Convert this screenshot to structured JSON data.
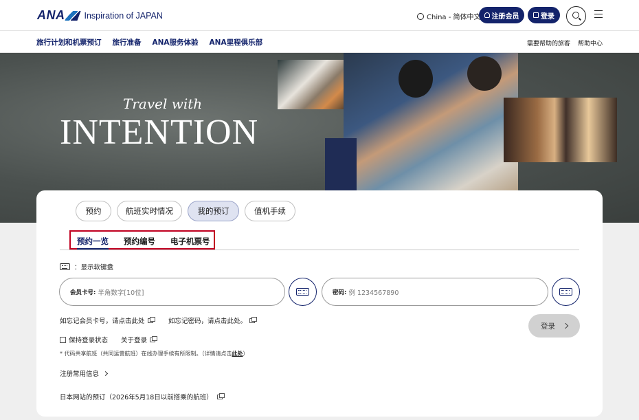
{
  "header": {
    "logo_text": "ANA",
    "tagline": "Inspiration of JAPAN",
    "language": "China - 简体中文",
    "register_label": "注册会员",
    "login_label": "登录"
  },
  "nav": {
    "left": [
      "旅行计划和机票预订",
      "旅行准备",
      "ANA服务体验",
      "ANA里程俱乐部"
    ],
    "right": [
      "需要帮助的旅客",
      "帮助中心"
    ]
  },
  "hero": {
    "line1": "Travel with",
    "line2": "INTENTION"
  },
  "booking": {
    "tabs": [
      "预约",
      "航班实时情况",
      "我的预订",
      "值机手续"
    ],
    "active_tab": "我的预订",
    "subtabs": [
      "预约一览",
      "预约编号",
      "电子机票号"
    ],
    "active_subtab": "预约一览",
    "soft_keyboard_label": "：显示软键盘",
    "member_field": {
      "label": "会员卡号:",
      "placeholder": "半角数字[10位]"
    },
    "password_field": {
      "label": "密码:",
      "placeholder": "例 1234567890"
    },
    "forgot_card": "如忘记会员卡号，请点击此处",
    "forgot_password": "如忘记密码，请点击此处。",
    "login_button": "登录",
    "keep_logged_in": "保持登录状态",
    "about_login": "关于登录",
    "note_text": "* 代码共享航班（共同运营航班）在线办理手续有所限制。（详情请点击",
    "note_link": "此处",
    "note_end": "）",
    "register_info": "注册常用信息",
    "japan_site": "日本网站的预订（2026年5月18日以前搭乘的航班）"
  },
  "colors": {
    "brand_navy": "#13236b",
    "highlight_red": "#c00020"
  }
}
